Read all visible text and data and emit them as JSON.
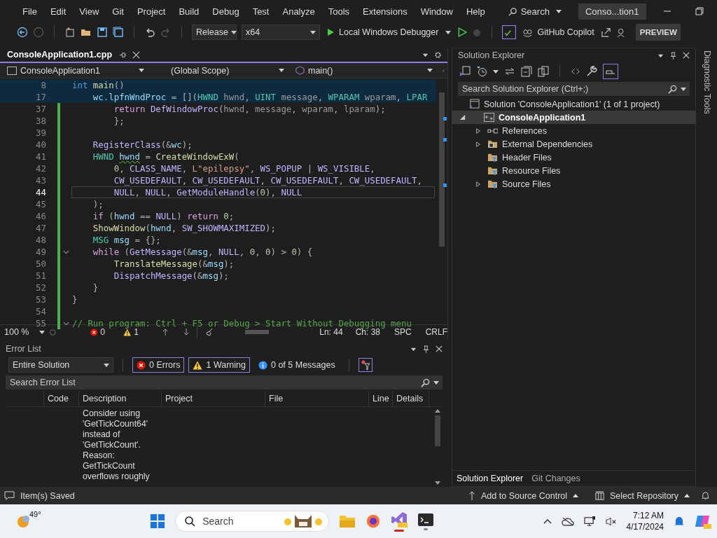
{
  "menu_bar": {
    "items": [
      "File",
      "Edit",
      "View",
      "Git",
      "Project",
      "Build",
      "Debug",
      "Test",
      "Analyze",
      "Tools",
      "Extensions",
      "Window",
      "Help"
    ],
    "search": "Search",
    "title": "Conso...tion1"
  },
  "toolbar": {
    "configuration": "Release",
    "platform": "x64",
    "debugger": "Local Windows Debugger",
    "copilot": "GitHub Copilot",
    "preview": "PREVIEW"
  },
  "editor": {
    "tab": {
      "label": "ConsoleApplication1.cpp",
      "selected": true
    },
    "nav": {
      "project": "ConsoleApplication1",
      "scope": "(Global Scope)",
      "member": "main()"
    },
    "lines": [
      {
        "number": "8",
        "sticky": true,
        "modified": false,
        "current": false,
        "fold": false,
        "tokens": [
          {
            "kind": "keyword",
            "text": "int"
          },
          {
            "kind": "function",
            "text": " main"
          },
          {
            "kind": "plain",
            "text": "()"
          }
        ]
      },
      {
        "number": "17",
        "sticky": true,
        "modified": false,
        "current": false,
        "fold": false,
        "tokens": [
          {
            "kind": "local",
            "text": "    wc"
          },
          {
            "kind": "plain",
            "text": "."
          },
          {
            "kind": "local",
            "text": "lpfnWndProc"
          },
          {
            "kind": "plain",
            "text": " = []("
          },
          {
            "kind": "type",
            "text": "HWND"
          },
          {
            "kind": "param",
            "text": " hwnd"
          },
          {
            "kind": "plain",
            "text": ", "
          },
          {
            "kind": "type",
            "text": "UINT"
          },
          {
            "kind": "param",
            "text": " message"
          },
          {
            "kind": "plain",
            "text": ", "
          },
          {
            "kind": "type",
            "text": "WPARAM"
          },
          {
            "kind": "param",
            "text": " wparam"
          },
          {
            "kind": "plain",
            "text": ", "
          },
          {
            "kind": "type",
            "text": "LPAR"
          }
        ]
      },
      {
        "number": "37",
        "sticky": false,
        "modified": true,
        "current": false,
        "fold": false,
        "tokens": [
          {
            "kind": "control",
            "text": "        return"
          },
          {
            "kind": "macro",
            "text": " DefWindowProc"
          },
          {
            "kind": "plain",
            "text": "("
          },
          {
            "kind": "param",
            "text": "hwnd"
          },
          {
            "kind": "plain",
            "text": ", "
          },
          {
            "kind": "param",
            "text": "message"
          },
          {
            "kind": "plain",
            "text": ", "
          },
          {
            "kind": "param",
            "text": "wparam"
          },
          {
            "kind": "plain",
            "text": ", "
          },
          {
            "kind": "param",
            "text": "lparam"
          },
          {
            "kind": "plain",
            "text": ");"
          }
        ]
      },
      {
        "number": "38",
        "sticky": false,
        "modified": true,
        "current": false,
        "fold": false,
        "tokens": [
          {
            "kind": "plain",
            "text": "        };"
          }
        ]
      },
      {
        "number": "39",
        "sticky": false,
        "modified": true,
        "current": false,
        "fold": false
      },
      {
        "number": "40",
        "sticky": false,
        "modified": true,
        "current": false,
        "fold": false,
        "tokens": [
          {
            "kind": "macro",
            "text": "    RegisterClass"
          },
          {
            "kind": "plain",
            "text": "(&"
          },
          {
            "kind": "local",
            "text": "wc"
          },
          {
            "kind": "plain",
            "text": ");"
          }
        ]
      },
      {
        "number": "41",
        "sticky": false,
        "modified": true,
        "current": false,
        "fold": false,
        "tokens": [
          {
            "kind": "type",
            "text": "    HWND "
          },
          {
            "kind": "local",
            "text": "hwnd",
            "warning": true
          },
          {
            "kind": "plain",
            "text": " = "
          },
          {
            "kind": "function",
            "text": "CreateWindowExW"
          },
          {
            "kind": "plain",
            "text": "("
          }
        ]
      },
      {
        "number": "42",
        "sticky": false,
        "modified": true,
        "current": false,
        "fold": false,
        "tokens": [
          {
            "kind": "number",
            "text": "        0"
          },
          {
            "kind": "plain",
            "text": ", "
          },
          {
            "kind": "macro",
            "text": "CLASS_NAME"
          },
          {
            "kind": "plain",
            "text": ", "
          },
          {
            "kind": "string",
            "text": "L\"epilepsy\""
          },
          {
            "kind": "plain",
            "text": ", "
          },
          {
            "kind": "macro",
            "text": "WS_POPUP"
          },
          {
            "kind": "plain",
            "text": " | "
          },
          {
            "kind": "macro",
            "text": "WS_VISIBLE"
          },
          {
            "kind": "plain",
            "text": ","
          }
        ]
      },
      {
        "number": "43",
        "sticky": false,
        "modified": true,
        "current": false,
        "fold": false,
        "tokens": [
          {
            "kind": "macro",
            "text": "        CW_USEDEFAULT"
          },
          {
            "kind": "plain",
            "text": ", "
          },
          {
            "kind": "macro",
            "text": "CW_USEDEFAULT"
          },
          {
            "kind": "plain",
            "text": ", "
          },
          {
            "kind": "macro",
            "text": "CW_USEDEFAULT"
          },
          {
            "kind": "plain",
            "text": ", "
          },
          {
            "kind": "macro",
            "text": "CW_USEDEFAULT"
          },
          {
            "kind": "plain",
            "text": ","
          }
        ]
      },
      {
        "number": "44",
        "sticky": false,
        "modified": true,
        "current": true,
        "fold": false,
        "tokens": [
          {
            "kind": "macro",
            "text": "        NULL"
          },
          {
            "kind": "plain",
            "text": ", "
          },
          {
            "kind": "macro",
            "text": "NULL"
          },
          {
            "kind": "plain",
            "text": ", "
          },
          {
            "kind": "macro",
            "text": "GetModuleHandle"
          },
          {
            "kind": "plain",
            "text": "("
          },
          {
            "kind": "number",
            "text": "0"
          },
          {
            "kind": "plain",
            "text": "), "
          },
          {
            "kind": "macro",
            "text": "NULL"
          }
        ]
      },
      {
        "number": "45",
        "sticky": false,
        "modified": true,
        "current": false,
        "fold": false,
        "tokens": [
          {
            "kind": "plain",
            "text": "    );"
          }
        ]
      },
      {
        "number": "46",
        "sticky": false,
        "modified": true,
        "current": false,
        "fold": false,
        "tokens": [
          {
            "kind": "control",
            "text": "    if"
          },
          {
            "kind": "plain",
            "text": " ("
          },
          {
            "kind": "local",
            "text": "hwnd"
          },
          {
            "kind": "plain",
            "text": " == "
          },
          {
            "kind": "macro",
            "text": "NULL"
          },
          {
            "kind": "plain",
            "text": ") "
          },
          {
            "kind": "control",
            "text": "return"
          },
          {
            "kind": "number",
            "text": " 0"
          },
          {
            "kind": "plain",
            "text": ";"
          }
        ]
      },
      {
        "number": "47",
        "sticky": false,
        "modified": true,
        "current": false,
        "fold": false,
        "tokens": [
          {
            "kind": "function",
            "text": "    ShowWindow"
          },
          {
            "kind": "plain",
            "text": "("
          },
          {
            "kind": "local",
            "text": "hwnd"
          },
          {
            "kind": "plain",
            "text": ", "
          },
          {
            "kind": "macro",
            "text": "SW_SHOWMAXIMIZED"
          },
          {
            "kind": "plain",
            "text": ");"
          }
        ]
      },
      {
        "number": "48",
        "sticky": false,
        "modified": true,
        "current": false,
        "fold": false,
        "tokens": [
          {
            "kind": "type",
            "text": "    MSG"
          },
          {
            "kind": "local",
            "text": " msg"
          },
          {
            "kind": "plain",
            "text": " = {};"
          }
        ]
      },
      {
        "number": "49",
        "sticky": false,
        "modified": true,
        "current": false,
        "fold": true,
        "tokens": [
          {
            "kind": "control",
            "text": "    while"
          },
          {
            "kind": "plain",
            "text": " ("
          },
          {
            "kind": "macro",
            "text": "GetMessage"
          },
          {
            "kind": "plain",
            "text": "(&"
          },
          {
            "kind": "local",
            "text": "msg"
          },
          {
            "kind": "plain",
            "text": ", "
          },
          {
            "kind": "macro",
            "text": "NULL"
          },
          {
            "kind": "plain",
            "text": ", "
          },
          {
            "kind": "number",
            "text": "0"
          },
          {
            "kind": "plain",
            "text": ", "
          },
          {
            "kind": "number",
            "text": "0"
          },
          {
            "kind": "plain",
            "text": ") > "
          },
          {
            "kind": "number",
            "text": "0"
          },
          {
            "kind": "plain",
            "text": ") {"
          }
        ]
      },
      {
        "number": "50",
        "sticky": false,
        "modified": true,
        "current": false,
        "fold": false,
        "tokens": [
          {
            "kind": "function",
            "text": "        TranslateMessage"
          },
          {
            "kind": "plain",
            "text": "(&"
          },
          {
            "kind": "local",
            "text": "msg"
          },
          {
            "kind": "plain",
            "text": ");"
          }
        ]
      },
      {
        "number": "51",
        "sticky": false,
        "modified": true,
        "current": false,
        "fold": false,
        "tokens": [
          {
            "kind": "macro",
            "text": "        DispatchMessage"
          },
          {
            "kind": "plain",
            "text": "(&"
          },
          {
            "kind": "local",
            "text": "msg"
          },
          {
            "kind": "plain",
            "text": ");"
          }
        ]
      },
      {
        "number": "52",
        "sticky": false,
        "modified": true,
        "current": false,
        "fold": false,
        "tokens": [
          {
            "kind": "plain",
            "text": "    }"
          }
        ]
      },
      {
        "number": "53",
        "sticky": false,
        "modified": true,
        "current": false,
        "fold": false,
        "tokens": [
          {
            "kind": "plain",
            "text": "}"
          }
        ]
      },
      {
        "number": "54",
        "sticky": false,
        "modified": true,
        "current": false,
        "fold": false
      },
      {
        "number": "55",
        "sticky": false,
        "modified": true,
        "current": false,
        "fold": true,
        "tokens": [
          {
            "kind": "comment",
            "text": "// Run program: Ctrl + F5 or Debug > Start Without Debugging menu"
          }
        ]
      }
    ],
    "status": {
      "zoom": "100 %",
      "errors": "0",
      "warnings": "1",
      "line": "Ln: 44",
      "column": "Ch: 38",
      "whitespace": "SPC",
      "line_ending": "CRLF"
    }
  },
  "error_list": {
    "title": "Error List",
    "scope": "Entire Solution",
    "filters": [
      {
        "kind": "error",
        "label": "0 Errors",
        "selected": true
      },
      {
        "kind": "warning",
        "label": "1 Warning",
        "selected": true
      },
      {
        "kind": "info",
        "label": "0 of 5 Messages",
        "selected": false
      }
    ],
    "search": {
      "placeholder": "Search Error List"
    },
    "columns": [
      "Code",
      "Description",
      "Project",
      "File",
      "Line",
      "Details"
    ],
    "rows": [
      {
        "description": "Consider using 'GetTickCount64' instead of 'GetTickCount'. Reason: GetTickCount overflows roughly"
      }
    ]
  },
  "solution_explorer": {
    "title": "Solution Explorer",
    "search": {
      "placeholder": "Search Solution Explorer (Ctrl+;)"
    },
    "tree": [
      {
        "kind": "solution",
        "label": "Solution 'ConsoleApplication1' (1 of 1 project)",
        "selected": false,
        "children": [
          {
            "kind": "project",
            "label": "ConsoleApplication1",
            "selected": true,
            "expanded": true,
            "children": [
              {
                "kind": "references",
                "label": "References",
                "selected": false,
                "expandable": true
              },
              {
                "kind": "external",
                "label": "External Dependencies",
                "selected": false,
                "expandable": true
              },
              {
                "kind": "filter",
                "label": "Header Files",
                "selected": false,
                "expandable": false
              },
              {
                "kind": "filter",
                "label": "Resource Files",
                "selected": false,
                "expandable": false
              },
              {
                "kind": "filter",
                "label": "Source Files",
                "selected": false,
                "expandable": true
              }
            ]
          }
        ]
      }
    ],
    "tabs": [
      {
        "label": "Solution Explorer",
        "selected": true
      },
      {
        "label": "Git Changes",
        "selected": false
      }
    ]
  },
  "side_tab": "Diagnostic Tools",
  "status_bar": {
    "message": "Item(s) Saved",
    "source_control": "Add to Source Control",
    "repository": "Select Repository"
  },
  "taskbar": {
    "weather": "49°",
    "search": "Search",
    "time": "7:12 AM",
    "date": "4/17/2024"
  }
}
